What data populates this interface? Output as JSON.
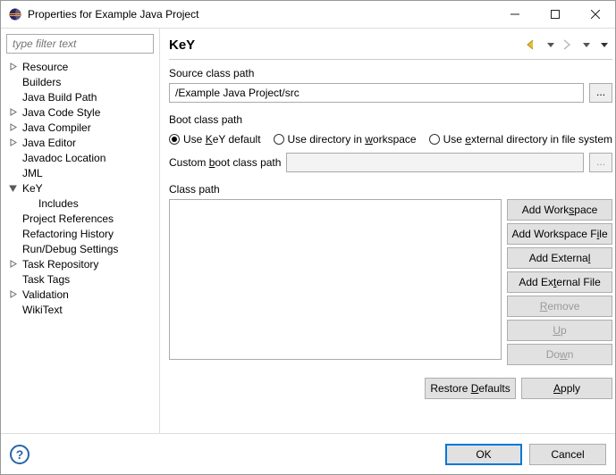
{
  "window": {
    "title": "Properties for Example Java Project"
  },
  "filter_placeholder": "type filter text",
  "tree": [
    {
      "label": "Resource",
      "expandable": true
    },
    {
      "label": "Builders",
      "expandable": false
    },
    {
      "label": "Java Build Path",
      "expandable": false
    },
    {
      "label": "Java Code Style",
      "expandable": true
    },
    {
      "label": "Java Compiler",
      "expandable": true
    },
    {
      "label": "Java Editor",
      "expandable": true
    },
    {
      "label": "Javadoc Location",
      "expandable": false
    },
    {
      "label": "JML",
      "expandable": false
    },
    {
      "label": "KeY",
      "expandable": true,
      "expanded": true,
      "children": [
        {
          "label": "Includes"
        }
      ]
    },
    {
      "label": "Project References",
      "expandable": false
    },
    {
      "label": "Refactoring History",
      "expandable": false
    },
    {
      "label": "Run/Debug Settings",
      "expandable": false
    },
    {
      "label": "Task Repository",
      "expandable": true
    },
    {
      "label": "Task Tags",
      "expandable": false
    },
    {
      "label": "Validation",
      "expandable": true
    },
    {
      "label": "WikiText",
      "expandable": false
    }
  ],
  "page": {
    "title": "KeY",
    "source_class_path_label": "Source class path",
    "source_class_path_value": "/Example Java Project/src",
    "boot_class_path_label": "Boot class path",
    "radio_use_default_pre": "Use ",
    "radio_use_default_key": "K",
    "radio_use_default_post": "eY default",
    "radio_workspace_pre": "Use directory in ",
    "radio_workspace_u": "w",
    "radio_workspace_post": "orkspace",
    "radio_external_pre": "Use ",
    "radio_external_u": "e",
    "radio_external_post": "xternal directory in file system",
    "custom_boot_label_pre": "Custom ",
    "custom_boot_label_u": "b",
    "custom_boot_label_post": "oot class path",
    "class_path_label": "Class path",
    "btn_add_workspace_pre": "Add Work",
    "btn_add_workspace_u": "s",
    "btn_add_workspace_post": "pace",
    "btn_add_workspace_file_pre": "Add Workspace F",
    "btn_add_workspace_file_u": "i",
    "btn_add_workspace_file_post": "le",
    "btn_add_external_pre": "Add Externa",
    "btn_add_external_u": "l",
    "btn_add_external_post": "",
    "btn_add_external_file_pre": "Add Ex",
    "btn_add_external_file_u": "t",
    "btn_add_external_file_post": "ernal File",
    "btn_remove_u": "R",
    "btn_remove_post": "emove",
    "btn_up_u": "U",
    "btn_up_post": "p",
    "btn_down_pre": "Do",
    "btn_down_u": "w",
    "btn_down_post": "n",
    "btn_restore_pre": "Restore ",
    "btn_restore_u": "D",
    "btn_restore_post": "efaults",
    "btn_apply_u": "A",
    "btn_apply_post": "pply",
    "btn_ok": "OK",
    "btn_cancel": "Cancel"
  }
}
